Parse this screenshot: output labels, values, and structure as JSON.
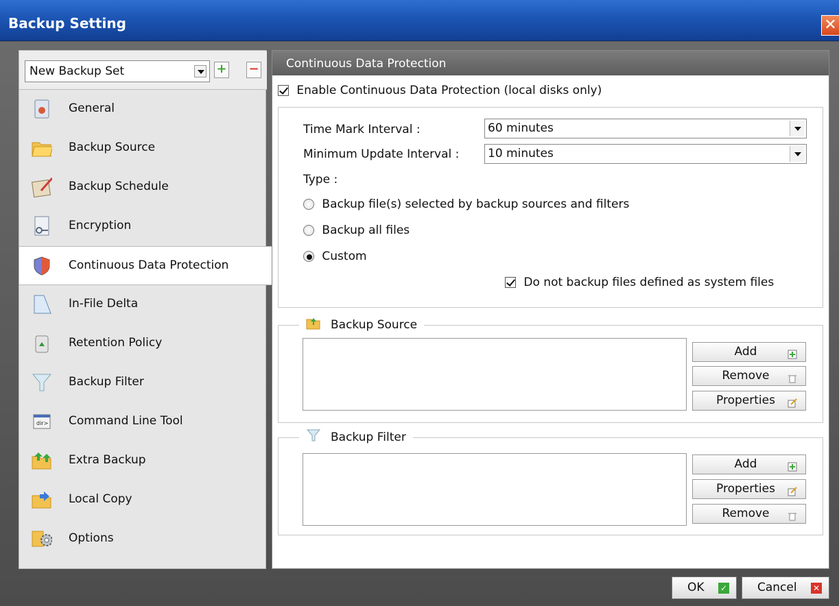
{
  "window": {
    "title": "Backup Setting",
    "close_symbol": "✕"
  },
  "sidebar": {
    "backup_set": "New Backup Set",
    "add_symbol": "+",
    "remove_symbol": "−",
    "items": [
      {
        "label": "General",
        "icon": "document-icon"
      },
      {
        "label": "Backup Source",
        "icon": "folder-icon"
      },
      {
        "label": "Backup Schedule",
        "icon": "schedule-icon"
      },
      {
        "label": "Encryption",
        "icon": "key-icon"
      },
      {
        "label": "Continuous Data Protection",
        "icon": "shield-icon"
      },
      {
        "label": "In-File Delta",
        "icon": "delta-icon"
      },
      {
        "label": "Retention Policy",
        "icon": "recycle-bin-icon"
      },
      {
        "label": "Backup Filter",
        "icon": "funnel-icon"
      },
      {
        "label": "Command Line Tool",
        "icon": "terminal-icon"
      },
      {
        "label": "Extra Backup",
        "icon": "extra-backup-icon"
      },
      {
        "label": "Local Copy",
        "icon": "local-copy-icon"
      },
      {
        "label": "Options",
        "icon": "gears-icon"
      }
    ]
  },
  "main": {
    "header": "Continuous Data Protection",
    "enable_label": "Enable Continuous Data Protection (local disks only)",
    "time_mark_label": "Time Mark Interval :",
    "time_mark_value": "60 minutes",
    "min_update_label": "Minimum Update Interval :",
    "min_update_value": "10 minutes",
    "type_label": "Type :",
    "type_options": [
      "Backup file(s) selected by backup sources and filters",
      "Backup all files",
      "Custom"
    ],
    "system_files_label": "Do not backup files defined as system files",
    "backup_source": {
      "title": "Backup Source",
      "buttons": [
        "Add",
        "Remove",
        "Properties"
      ]
    },
    "backup_filter": {
      "title": "Backup Filter",
      "buttons": [
        "Add",
        "Properties",
        "Remove"
      ]
    }
  },
  "footer": {
    "ok_label": "OK",
    "cancel_label": "Cancel"
  },
  "colors": {
    "title_bar": "#1c55b4",
    "active_item": "#ffffff",
    "panel_header": "#6b6b6b"
  }
}
